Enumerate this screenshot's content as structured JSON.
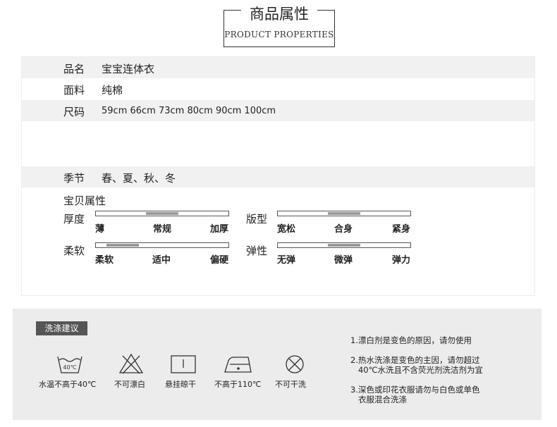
{
  "header": {
    "title_cn": "商品属性",
    "title_en": "PRODUCT PROPERTIES"
  },
  "properties": [
    {
      "key": "品名",
      "value": "宝宝连体衣"
    },
    {
      "key": "面料",
      "value": "纯棉"
    },
    {
      "key": "尺码",
      "value": "59cm 66cm 73cm 80cm 90cm 100cm"
    },
    {
      "key": "季节",
      "value": "春、夏、秋、冬"
    }
  ],
  "attributes": {
    "title": "宝贝属性",
    "scales": [
      {
        "label": "厚度",
        "options": [
          "薄",
          "常规",
          "加厚"
        ],
        "level": 0.5
      },
      {
        "label": "版型",
        "options": [
          "宽松",
          "合身",
          "紧身"
        ],
        "level": 0.5
      },
      {
        "label": "柔软",
        "options": [
          "柔软",
          "适中",
          "偏硬"
        ],
        "level": 0.2
      },
      {
        "label": "弹性",
        "options": [
          "无弹",
          "微弹",
          "弹力"
        ],
        "level": 0.5
      }
    ]
  },
  "wash": {
    "tag": "洗涤建议",
    "icons": [
      {
        "name": "wash-40-icon",
        "label": "水温不高于40℃",
        "glyph": "40℃"
      },
      {
        "name": "no-bleach-icon",
        "label": "不可漂白"
      },
      {
        "name": "hang-dry-icon",
        "label": "悬挂晾干"
      },
      {
        "name": "iron-icon",
        "label": "不高于110℃"
      },
      {
        "name": "no-dry-clean-icon",
        "label": "不可干洗"
      }
    ],
    "notes": [
      "1.漂白剂是变色的原因，请勿使用",
      "2.热水洗涤是变色的主因，请勿超过\n   40℃水洗且不含荧光剂洗洁剂为宜",
      "3.深色或印花衣服请勿与白色或单色\n   衣服混合洗涤"
    ]
  },
  "colors": {
    "bar_fill": "#999999",
    "shade": "#f1f1f1",
    "wash_bg": "#ececec",
    "tag_bg": "#555555"
  }
}
